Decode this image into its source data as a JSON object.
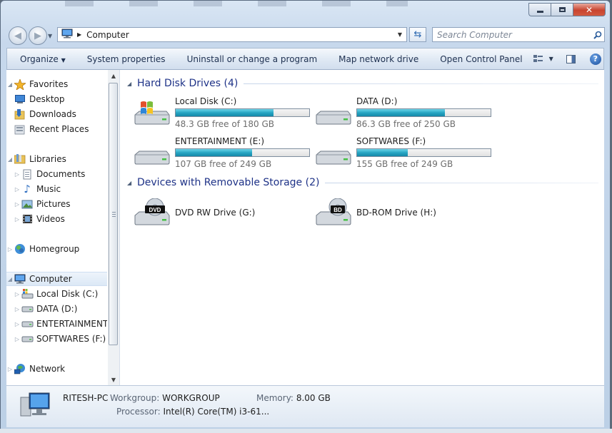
{
  "nav": {
    "back_label": "Back",
    "forward_label": "Forward"
  },
  "address": {
    "path": "Computer"
  },
  "search": {
    "placeholder": "Search Computer"
  },
  "toolbar": {
    "organize": "Organize",
    "system_properties": "System properties",
    "uninstall": "Uninstall or change a program",
    "map_drive": "Map network drive",
    "control_panel": "Open Control Panel"
  },
  "sidebar": {
    "favorites": "Favorites",
    "desktop": "Desktop",
    "downloads": "Downloads",
    "recent": "Recent Places",
    "libraries": "Libraries",
    "documents": "Documents",
    "music": "Music",
    "pictures": "Pictures",
    "videos": "Videos",
    "homegroup": "Homegroup",
    "computer": "Computer",
    "local_disk": "Local Disk (C:)",
    "data": "DATA (D:)",
    "entertainment": "ENTERTAINMENT",
    "softwares": "SOFTWARES (F:)",
    "network": "Network"
  },
  "groups": {
    "hdd_title": "Hard Disk Drives (4)",
    "removable_title": "Devices with Removable Storage (2)"
  },
  "drives": [
    {
      "name": "Local Disk (C:)",
      "free_text": "48.3 GB free of 180 GB",
      "used_fraction": 0.73,
      "windows": true
    },
    {
      "name": "DATA (D:)",
      "free_text": "86.3 GB free of 250 GB",
      "used_fraction": 0.66
    },
    {
      "name": "ENTERTAINMENT (E:)",
      "free_text": "107 GB free of 249 GB",
      "used_fraction": 0.57
    },
    {
      "name": "SOFTWARES (F:)",
      "free_text": "155 GB free of 249 GB",
      "used_fraction": 0.38
    }
  ],
  "devices": [
    {
      "name": "DVD RW Drive (G:)",
      "badge": "DVD"
    },
    {
      "name": "BD-ROM Drive (H:)",
      "badge": "BD"
    }
  ],
  "details": {
    "pc_name": "RITESH-PC",
    "workgroup_label": "Workgroup:",
    "workgroup": "WORKGROUP",
    "memory_label": "Memory:",
    "memory": "8.00 GB",
    "processor_label": "Processor:",
    "processor": "Intel(R) Core(TM) i3-61..."
  },
  "colors": {
    "bar_fill": "#27a6c3",
    "group_heading": "#1e3287",
    "close_button": "#c8442f"
  }
}
